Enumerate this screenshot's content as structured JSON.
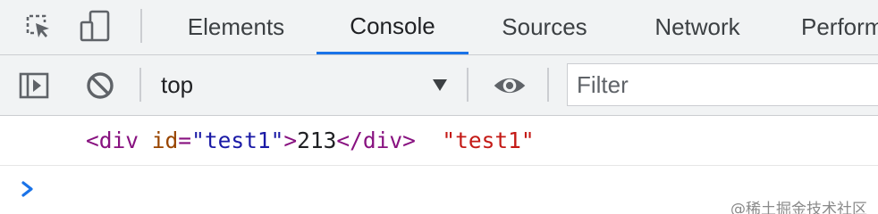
{
  "devtools": {
    "tabs": [
      {
        "label": "Elements"
      },
      {
        "label": "Console"
      },
      {
        "label": "Sources"
      },
      {
        "label": "Network"
      },
      {
        "label": "Perform"
      }
    ],
    "active_tab": "Console",
    "left_icons": [
      "inspect-element-icon",
      "device-toolbar-icon"
    ]
  },
  "console_toolbar": {
    "icons": [
      "sidebar-toggle-icon",
      "clear-console-icon",
      "eye-icon"
    ],
    "context": "top",
    "filter_placeholder": "Filter"
  },
  "console": {
    "log_entry": {
      "open_tag_start": "<div",
      "attr_name": "id",
      "attr_eq": "=",
      "attr_value": "\"test1\"",
      "open_tag_end": ">",
      "content": "213",
      "close_tag": "</div>",
      "string_value": "\"test1\""
    },
    "prompt_icon": "chevron-right-icon"
  },
  "watermark": "@稀土掘金技术社区",
  "colors": {
    "accent": "#1a73e8",
    "toolbar_bg": "#f1f3f4",
    "tag": "#881280",
    "attr": "#994500",
    "attr_value": "#1a1aa6",
    "string": "#c41a16"
  }
}
